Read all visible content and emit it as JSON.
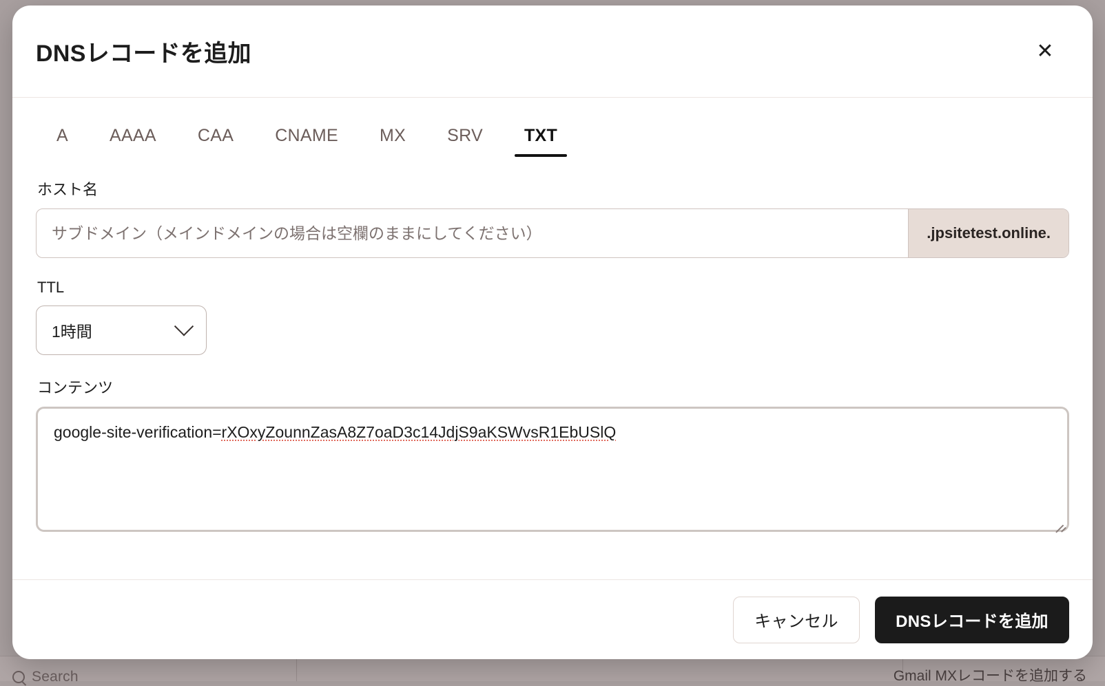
{
  "background": {
    "search_label": "Search",
    "right_text": "Gmail MXレコードを追加する"
  },
  "modal": {
    "title": "DNSレコードを追加",
    "close_icon": "close-icon",
    "tabs": [
      {
        "label": "A",
        "active": false
      },
      {
        "label": "AAAA",
        "active": false
      },
      {
        "label": "CAA",
        "active": false
      },
      {
        "label": "CNAME",
        "active": false
      },
      {
        "label": "MX",
        "active": false
      },
      {
        "label": "SRV",
        "active": false
      },
      {
        "label": "TXT",
        "active": true
      }
    ],
    "host": {
      "label": "ホスト名",
      "placeholder": "サブドメイン（メインドメインの場合は空欄のままにしてください）",
      "value": "",
      "suffix": ".jpsitetest.online."
    },
    "ttl": {
      "label": "TTL",
      "value": "1時間",
      "chevron_icon": "chevron-down-icon"
    },
    "content": {
      "label": "コンテンツ",
      "prefix": "google-site-verification=",
      "token": "rXOxyZounnZasA8Z7oaD3c14JdjS9aKSWvsR1EbUSlQ",
      "value": "google-site-verification=rXOxyZounnZasA8Z7oaD3c14JdjS9aKSWvsR1EbUSlQ"
    },
    "footer": {
      "cancel_label": "キャンセル",
      "submit_label": "DNSレコードを追加"
    }
  },
  "colors": {
    "backdrop": "#a9a0a0",
    "modal_bg": "#ffffff",
    "accent_dark": "#1b1b1b",
    "suffix_bg": "#e7dcd6",
    "border": "#cfc3bf",
    "spellcheck_underline": "#e06a5c"
  }
}
